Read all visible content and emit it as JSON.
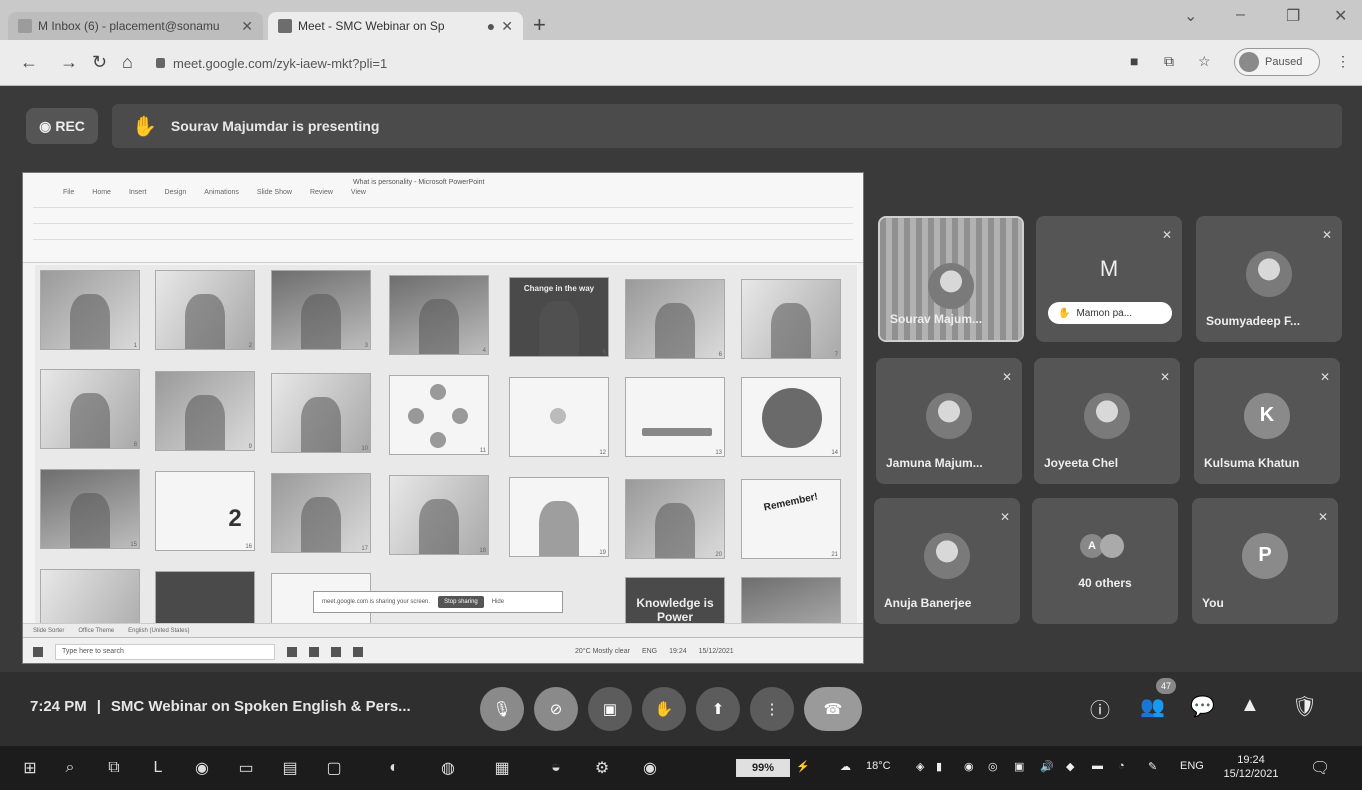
{
  "browser": {
    "tabs": [
      {
        "title": "M Inbox (6) - placement@sonamu",
        "active": false
      },
      {
        "title": "Meet - SMC Webinar on Sp",
        "active": true
      }
    ],
    "new_tab": "+",
    "url": "meet.google.com/zyk-iaew-mkt?pli=1",
    "profile_status": "Paused",
    "window_controls": [
      "⌄",
      "–",
      "❐",
      "✕"
    ]
  },
  "meet": {
    "rec_label": "REC",
    "presenting_text": "Sourav Majumdar is presenting",
    "meeting_time": "7:24 PM",
    "separator": "|",
    "meeting_title": "SMC Webinar on Spoken English & Pers...",
    "participants_badge": "47",
    "tiles": [
      {
        "name": "Sourav Majum...",
        "type": "video",
        "presenter": true
      },
      {
        "name": "Mamon pa...",
        "letter": "M",
        "type": "letter-pill"
      },
      {
        "name": "Soumyadeep F...",
        "type": "photo"
      },
      {
        "name": "Jamuna Majum...",
        "type": "photo"
      },
      {
        "name": "Joyeeta Chel",
        "type": "photo"
      },
      {
        "name": "Kulsuma Khatun",
        "letter": "K",
        "type": "letter"
      },
      {
        "name": "Anuja Banerjee",
        "type": "photo"
      },
      {
        "name": "40 others",
        "letter": "A",
        "type": "others"
      },
      {
        "name": "You",
        "letter": "P",
        "type": "letter"
      }
    ]
  },
  "shared_screen": {
    "window_title": "What is personality - Microsoft PowerPoint",
    "menus": [
      "File",
      "Home",
      "Insert",
      "Design",
      "Animations",
      "Slide Show",
      "Review",
      "View"
    ],
    "slide_texts": {
      "knowledge": "Knowledge is Power",
      "remember": "Remember!",
      "change": "Change in the way",
      "number2": "2"
    },
    "sharing_bar": "meet.google.com is sharing your screen.",
    "stop_sharing": "Stop sharing",
    "hide": "Hide",
    "status_items": [
      "Slide Sorter",
      "Office Theme",
      "English (United States)"
    ],
    "search_placeholder": "Type here to search",
    "weather": "20°C Mostly clear",
    "lang": "ENG",
    "time": "19:24",
    "date": "15/12/2021"
  },
  "taskbar": {
    "battery": "99%",
    "temperature": "18°C",
    "language": "ENG",
    "time": "19:24",
    "date": "15/12/2021"
  }
}
